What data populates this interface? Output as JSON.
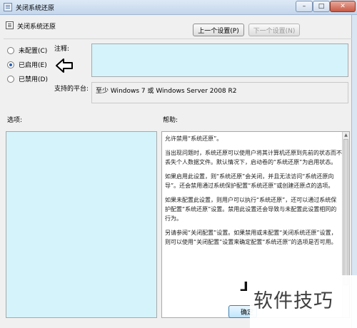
{
  "window": {
    "title": "关闭系统还原",
    "min_glyph": "–",
    "max_glyph": "□",
    "close_glyph": "✕"
  },
  "header": {
    "title": "关闭系统还原",
    "prev_button": "上一个设置(P)",
    "next_button": "下一个设置(N)"
  },
  "radios": {
    "not_configured": "未配置(C)",
    "enabled": "已启用(E)",
    "disabled": "已禁用(D)",
    "selected": "enabled"
  },
  "labels": {
    "comment": "注释:",
    "supported_on": "支持的平台:",
    "options": "选项:",
    "help": "帮助:"
  },
  "supported_on_value": "至少 Windows 7 或 Windows Server 2008 R2",
  "help_paragraphs": [
    "允许禁用“系统还原”。",
    "当出现问题时，系统还原可以使用户将其计算机还原到先前的状态而不丢失个人数据文件。默认情况下，启动卷的“系统还原”为启用状态。",
    "如果启用此设置，则“系统还原”会关闭，并且无法访问“系统还原向导”。还会禁用通过系统保护配置“系统还原”或创建还原点的选项。",
    "如果未配置此设置，则用户可以执行“系统还原”，还可以通过系统保护配置“系统还原”设置。禁用此设置还会导致与未配置此设置相同的行为。",
    "另请参阅“关闭配置”设置。如果禁用或未配置“关闭系统还原”设置，则可以使用“关闭配置”设置来确定配置“系统还原”的选项是否可用。"
  ],
  "footer": {
    "ok_button": "确定"
  },
  "watermark": {
    "text": "软件技巧"
  },
  "colors": {
    "panel_bg": "#d5f3fa",
    "dialog_bg": "#f0f0f0"
  }
}
